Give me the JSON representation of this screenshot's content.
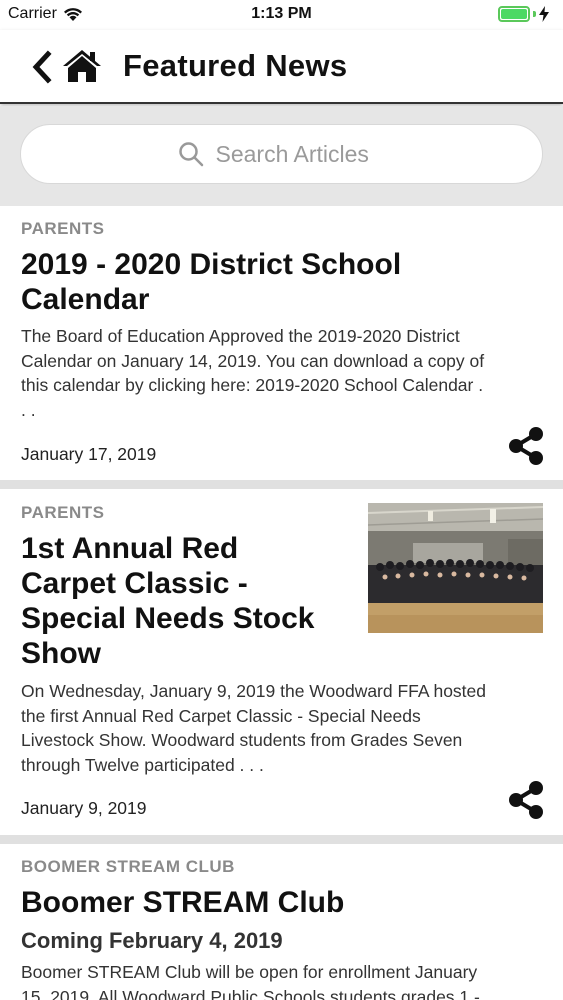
{
  "status_bar": {
    "carrier": "Carrier",
    "time": "1:13 PM",
    "battery_level": 1.0
  },
  "nav": {
    "title": "Featured News",
    "back_icon": "chevron-left-icon",
    "home_icon": "home-icon"
  },
  "search": {
    "placeholder": "Search Articles",
    "icon": "search-icon"
  },
  "articles": [
    {
      "category": "PARENTS",
      "title_lines": [
        "2019 - 2020 District School",
        "Calendar"
      ],
      "excerpt_lines": [
        "The Board of Education Approved the 2019-2020 District",
        "Calendar on January 14, 2019.   You can download a copy of",
        "this calendar by clicking here:  2019-2020 School Calendar .",
        ". ."
      ],
      "date": "January 17, 2019",
      "share_icon": "share-icon"
    },
    {
      "category": "PARENTS",
      "title_lines": [
        "1st Annual Red",
        "Carpet Classic -",
        "Special Needs Stock",
        "Show"
      ],
      "excerpt_lines": [
        "On Wednesday, January 9, 2019 the Woodward FFA hosted",
        "the first Annual Red Carpet Classic - Special Needs",
        "Livestock Show.  Woodward students from Grades Seven",
        "through Twelve participated . . ."
      ],
      "date": "January 9, 2019",
      "share_icon": "share-icon"
    },
    {
      "category": "BOOMER STREAM CLUB",
      "title_lines": [
        "Boomer STREAM Club"
      ],
      "subtitle": "Coming February 4, 2019",
      "excerpt_lines": [
        "Boomer STREAM Club will be open for enrollment January",
        "15, 2019.  All Woodward Public Schools students grades 1 -"
      ]
    }
  ],
  "colors": {
    "accent": "#000000",
    "battery": "#4cd964",
    "category_text": "#8a8a8a",
    "divider": "#e0e0e0"
  }
}
